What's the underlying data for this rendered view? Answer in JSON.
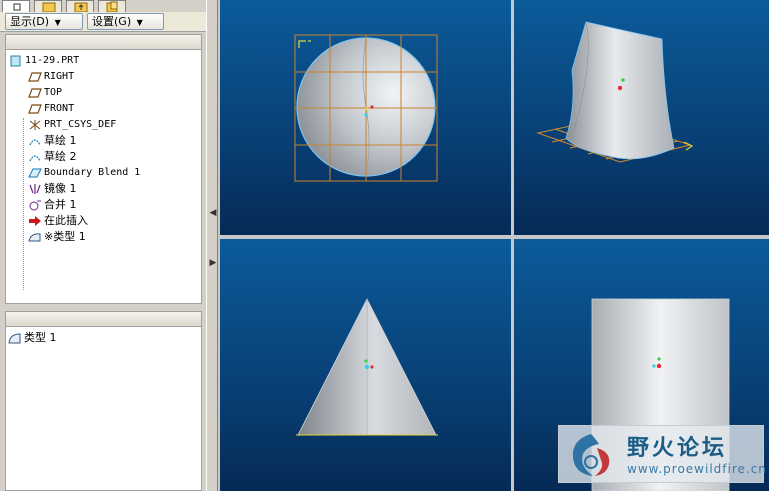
{
  "toolbar": {
    "show_label": "显示",
    "show_key": "(D)",
    "settings_label": "设置",
    "settings_key": "(G)"
  },
  "model_tree": {
    "root": "11-29.PRT",
    "items": [
      {
        "label": "RIGHT",
        "icon": "datum-plane-icon"
      },
      {
        "label": "TOP",
        "icon": "datum-plane-icon"
      },
      {
        "label": "FRONT",
        "icon": "datum-plane-icon"
      },
      {
        "label": "PRT_CSYS_DEF",
        "icon": "coordinate-system-icon"
      },
      {
        "label": "草绘 1",
        "icon": "sketch-icon"
      },
      {
        "label": "草绘 2",
        "icon": "sketch-icon"
      },
      {
        "label": "Boundary Blend 1",
        "icon": "boundary-blend-icon"
      },
      {
        "label": "镜像 1",
        "icon": "mirror-icon"
      },
      {
        "label": "合并 1",
        "icon": "merge-icon"
      },
      {
        "label": "在此插入",
        "icon": "insert-here-arrow-icon"
      },
      {
        "label": "※类型 1",
        "icon": "style-feature-icon"
      }
    ]
  },
  "selection_list": {
    "items": [
      {
        "label": "类型 1",
        "icon": "style-feature-icon"
      }
    ]
  },
  "watermark": {
    "title": "野火论坛",
    "url": "www.proewildfire.cn"
  },
  "colors": {
    "viewport_top": "#0b5b9a",
    "viewport_bottom": "#052a55",
    "grid": "#c8842c",
    "surface": "#c9cdd2"
  }
}
